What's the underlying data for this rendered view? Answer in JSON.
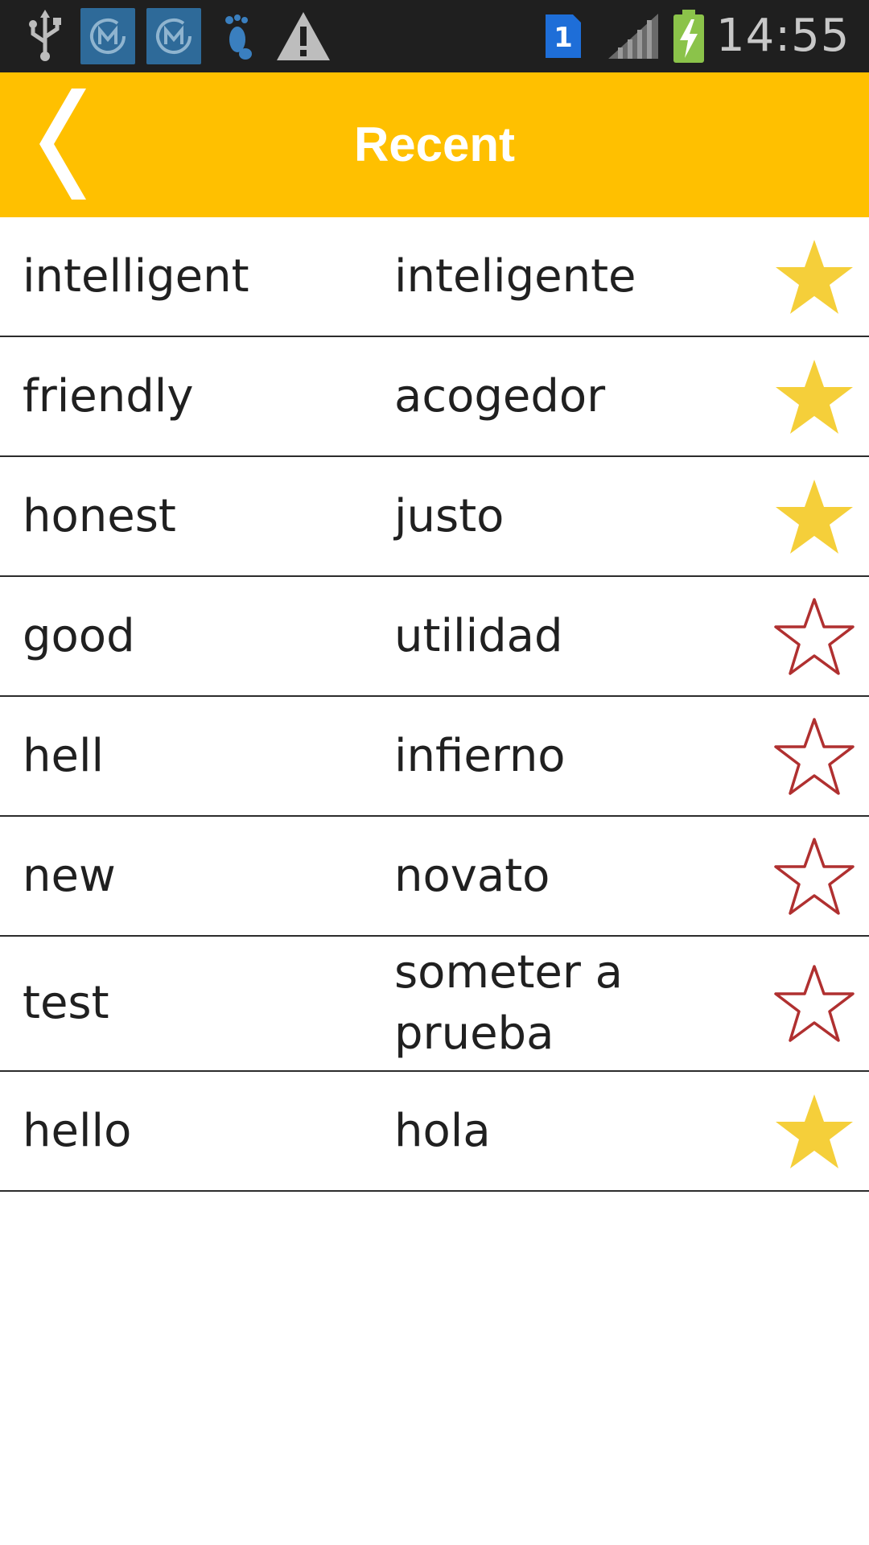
{
  "status_bar": {
    "time": "14:55",
    "sim_badge": "1",
    "icons": [
      "usb-icon",
      "m-app-icon",
      "m-app-icon",
      "footprint-icon",
      "warning-icon",
      "sim-icon",
      "signal-icon",
      "battery-charging-icon"
    ]
  },
  "app_bar": {
    "title": "Recent",
    "back_icon": "chevron-left-icon",
    "background_color": "#ffc000"
  },
  "colors": {
    "star_filled": "#f5cf3a",
    "star_outline": "#b03030"
  },
  "words": [
    {
      "english": "intelligent",
      "spanish": "inteligente",
      "favorite": true
    },
    {
      "english": "friendly",
      "spanish": "acogedor",
      "favorite": true
    },
    {
      "english": "honest",
      "spanish": "justo",
      "favorite": true
    },
    {
      "english": "good",
      "spanish": "utilidad",
      "favorite": false
    },
    {
      "english": "hell",
      "spanish": "infierno",
      "favorite": false
    },
    {
      "english": "new",
      "spanish": "novato",
      "favorite": false
    },
    {
      "english": "test",
      "spanish": "someter a prueba",
      "favorite": false
    },
    {
      "english": "hello",
      "spanish": "hola",
      "favorite": true
    }
  ]
}
